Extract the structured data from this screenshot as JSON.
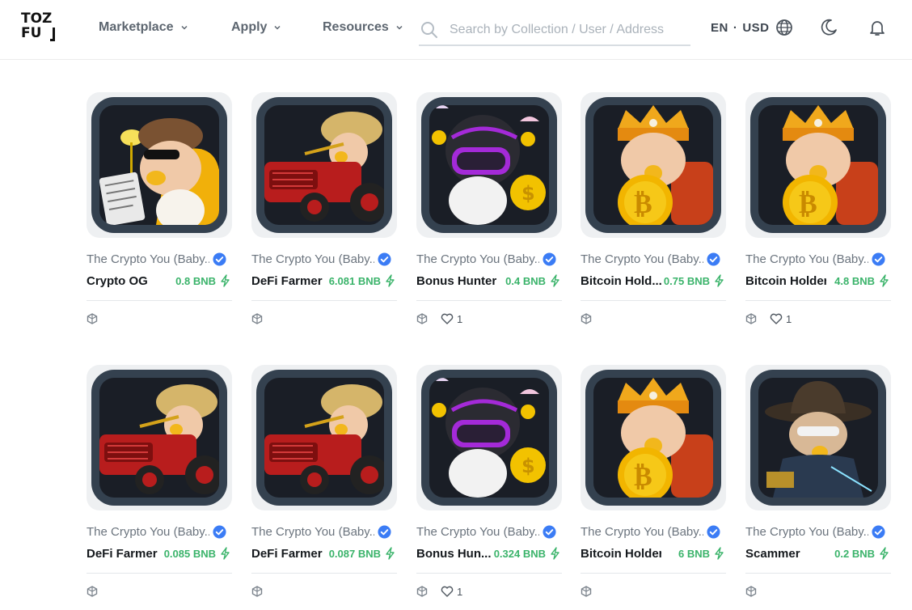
{
  "header": {
    "logo": "TOZ FU",
    "nav": [
      {
        "label": "Marketplace"
      },
      {
        "label": "Apply"
      },
      {
        "label": "Resources"
      }
    ],
    "search": {
      "placeholder": "Search by Collection / User / Address"
    },
    "language": "EN",
    "separator": "·",
    "currency": "USD",
    "icons": [
      "search-icon",
      "globe-icon",
      "moon-icon",
      "bell-icon",
      "chevron-down-icon"
    ]
  },
  "items": [
    {
      "collection": "The Crypto You (Baby...",
      "name": "Crypto OG",
      "price": "0.8 BNB",
      "likes": "",
      "art": "og"
    },
    {
      "collection": "The Crypto You (Baby...",
      "name": "DeFi Farmer",
      "price": "6.081 BNB",
      "likes": "",
      "art": "farmer"
    },
    {
      "collection": "The Crypto You (Baby...",
      "name": "Bonus Hunter",
      "price": "0.4 BNB",
      "likes": "1",
      "art": "hunter"
    },
    {
      "collection": "The Crypto You (Baby...",
      "name": "Bitcoin Hold...",
      "price": "0.75 BNB",
      "likes": "",
      "art": "bitcoin"
    },
    {
      "collection": "The Crypto You (Baby...",
      "name": "Bitcoin Holder",
      "price": "4.8 BNB",
      "likes": "1",
      "art": "bitcoin"
    },
    {
      "collection": "The Crypto You (Baby...",
      "name": "DeFi Farmer",
      "price": "0.085 BNB",
      "likes": "",
      "art": "farmer"
    },
    {
      "collection": "The Crypto You (Baby...",
      "name": "DeFi Farmer",
      "price": "0.087 BNB",
      "likes": "",
      "art": "farmer"
    },
    {
      "collection": "The Crypto You (Baby...",
      "name": "Bonus Hun...",
      "price": "0.324 BNB",
      "likes": "1",
      "art": "hunter"
    },
    {
      "collection": "The Crypto You (Baby...",
      "name": "Bitcoin Holder",
      "price": "6 BNB",
      "likes": "",
      "art": "bitcoin"
    },
    {
      "collection": "The Crypto You (Baby...",
      "name": "Scammer",
      "price": "0.2 BNB",
      "likes": "",
      "art": "scammer"
    }
  ],
  "colors": {
    "price_green": "#3ab36a",
    "verified_blue": "#3b7cf5",
    "card_frame": "#34414f",
    "nav_text": "#5d6670"
  }
}
